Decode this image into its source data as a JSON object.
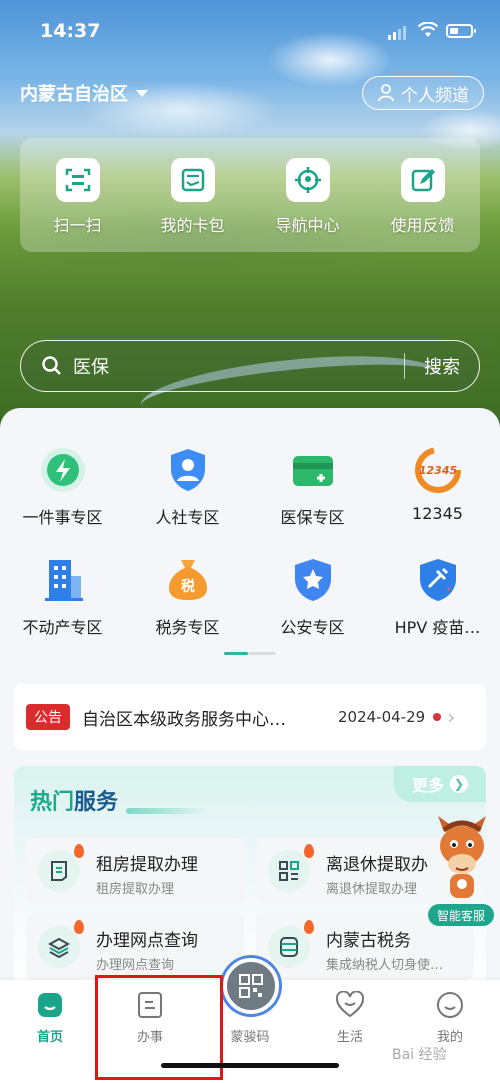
{
  "status_bar": {
    "time": "14:37"
  },
  "header": {
    "region": "内蒙古自治区",
    "channel_label": "个人频道"
  },
  "quick_actions": [
    {
      "label": "扫一扫",
      "icon": "scan-icon"
    },
    {
      "label": "我的卡包",
      "icon": "card-wallet-icon"
    },
    {
      "label": "导航中心",
      "icon": "location-target-icon"
    },
    {
      "label": "使用反馈",
      "icon": "feedback-edit-icon"
    }
  ],
  "search": {
    "query": "医保",
    "button": "搜索"
  },
  "services": [
    {
      "label": "一件事专区",
      "icon": "lightning-icon"
    },
    {
      "label": "人社专区",
      "icon": "person-shield-icon"
    },
    {
      "label": "医保专区",
      "icon": "medical-card-icon"
    },
    {
      "label": "12345",
      "icon": "hotline-12345-icon"
    },
    {
      "label": "不动产专区",
      "icon": "building-icon"
    },
    {
      "label": "税务专区",
      "icon": "tax-bag-icon"
    },
    {
      "label": "公安专区",
      "icon": "police-star-icon"
    },
    {
      "label": "HPV 疫苗…",
      "icon": "vaccine-shield-icon"
    }
  ],
  "notice": {
    "tag": "公告",
    "text": "自治区本级政务服务中心…",
    "date": "2024-04-29"
  },
  "hot_services": {
    "title_part1": "热门",
    "title_part2": "服务",
    "more_label": "更多",
    "items": [
      {
        "name": "租房提取办理",
        "desc": "租房提取办理",
        "icon": "document-icon"
      },
      {
        "name": "离退休提取办",
        "desc": "离退休提取办理",
        "icon": "grid-apps-icon"
      },
      {
        "name": "办理网点查询",
        "desc": "办理网点查询",
        "icon": "layers-icon"
      },
      {
        "name": "内蒙古税务",
        "desc": "集成纳税人切身使…",
        "icon": "database-icon"
      }
    ]
  },
  "assistant": {
    "label": "智能客服"
  },
  "tabbar": [
    {
      "label": "首页",
      "icon": "home-icon",
      "active": true
    },
    {
      "label": "办事",
      "icon": "tasks-icon",
      "active": false
    },
    {
      "label": "蒙骏码",
      "icon": "qr-code-icon",
      "active": false
    },
    {
      "label": "生活",
      "icon": "heart-icon",
      "active": false
    },
    {
      "label": "我的",
      "icon": "profile-face-icon",
      "active": false
    }
  ],
  "watermark": "Bai 经验",
  "colors": {
    "accent": "#1aa58a",
    "notice_tag": "#d92d2d",
    "highlight_box": "#e01818"
  }
}
